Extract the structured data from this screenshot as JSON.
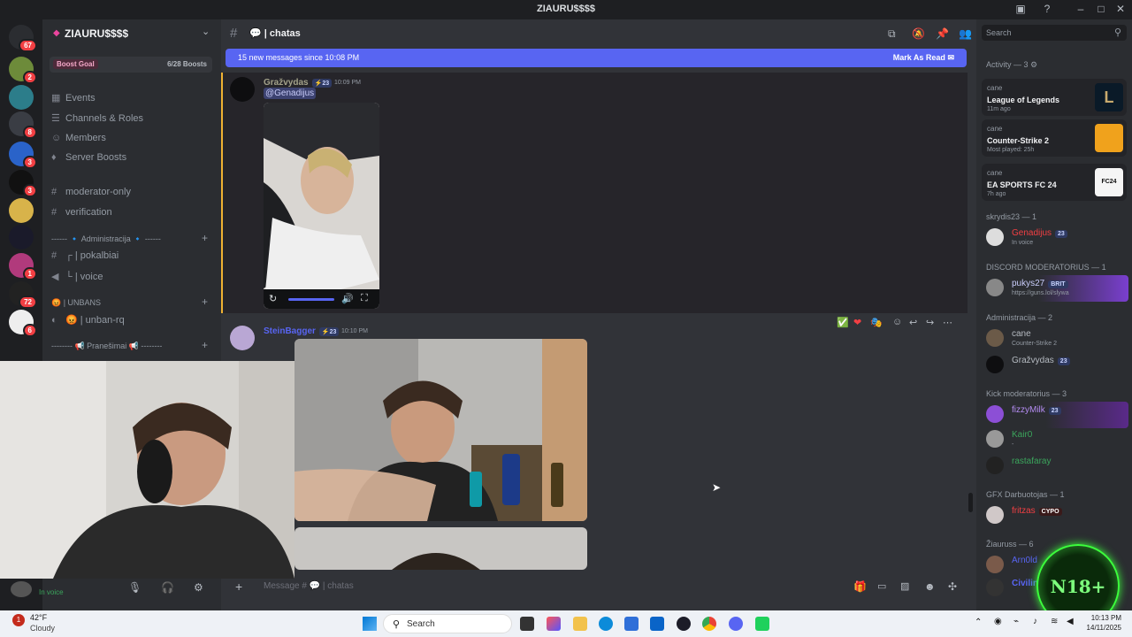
{
  "window": {
    "title": "ZIAURU$$$$"
  },
  "rail_badges": [
    "67",
    "2",
    "8",
    "3",
    "3",
    "1",
    "72",
    "6"
  ],
  "server": {
    "name": "ZIAURU$$$$",
    "boost_goal_label": "Boost Goal",
    "boost_progress": "6/28 Boosts",
    "boost_fraction": 0.214,
    "menu": [
      "Events",
      "Channels & Roles",
      "Members",
      "Server Boosts"
    ],
    "channels_top": [
      "moderator-only",
      "verification"
    ],
    "cat_admin": "------ 🔹 Administracija 🔹 ------",
    "admin_channels": [
      "┌ | pokalbiai",
      "└ | voice"
    ],
    "cat_unbans": "| UNBANS",
    "unban_channel": "| unban-rq",
    "cat_pranesimai": "-------- 📢 Pranešimai 📢 --------"
  },
  "channel": {
    "name": "| chatas"
  },
  "banner": {
    "text": "15 new messages since 10:08 PM",
    "action": "Mark As Read"
  },
  "messages": [
    {
      "author": "Gražvydas",
      "level": "23",
      "time": "10:09 PM",
      "mention": "@Genadijus"
    },
    {
      "author": "SteinBagger",
      "level": "23",
      "time": "10:10 PM"
    }
  ],
  "input": {
    "placeholder": "Message # 💬 | chatas"
  },
  "members": {
    "search_placeholder": "Search",
    "activity_header": "Activity — 3",
    "activities": [
      {
        "user": "cane",
        "game": "League of Legends",
        "sub": "11m ago"
      },
      {
        "user": "cane",
        "game": "Counter-Strike 2",
        "sub": "Most played: 25h"
      },
      {
        "user": "cane",
        "game": "EA SPORTS FC 24",
        "sub": "7h ago"
      }
    ],
    "groups": [
      {
        "header": "skrydis23 — 1",
        "rows": [
          {
            "name": "Genadijus",
            "tag": "23",
            "status": "In voice",
            "color": "#f23f43"
          }
        ]
      },
      {
        "header": "DISCORD MODERATORIUS — 1",
        "rows": [
          {
            "name": "pukys27",
            "tag": "BRIT",
            "status": "https://guns.lol/slywa",
            "color": "#c9cdfb"
          }
        ]
      },
      {
        "header": "Administracija — 2",
        "rows": [
          {
            "name": "cane",
            "tag": "",
            "status": "Counter-Strike 2",
            "color": "#b5bac1"
          },
          {
            "name": "Gražvydas",
            "tag": "23",
            "status": "",
            "color": "#b5bac1"
          }
        ]
      },
      {
        "header": "Kick moderatorius — 3",
        "rows": [
          {
            "name": "fizzyMilk",
            "tag": "23",
            "status": "",
            "color": "#b48cf2"
          },
          {
            "name": "Kair0",
            "tag": "",
            "status": "-",
            "color": "#3ba55c"
          },
          {
            "name": "rastafaray",
            "tag": "",
            "status": "",
            "color": "#3ba55c"
          }
        ]
      },
      {
        "header": "GFX Darbuotojas — 1",
        "rows": [
          {
            "name": "fritzas",
            "tag": "CYPO",
            "status": "",
            "color": "#f23f43"
          }
        ]
      },
      {
        "header": "Žiauruss — 6",
        "rows": [
          {
            "name": "Arn0ld",
            "tag": "",
            "status": "",
            "color": "#5865f2"
          },
          {
            "name": "Civilin",
            "tag": "",
            "status": "",
            "color": "#5865f2"
          }
        ]
      }
    ]
  },
  "user_panel": {
    "status": "In voice"
  },
  "overlay": {
    "logo_text": "N18+"
  },
  "taskbar": {
    "weather_temp": "42°F",
    "weather_desc": "Cloudy",
    "search_label": "Search",
    "time": "10:13 PM",
    "date": "14/11/2025"
  },
  "colors": {
    "blurple": "#5865f2",
    "danger": "#f23f43",
    "online": "#3ba55c"
  }
}
